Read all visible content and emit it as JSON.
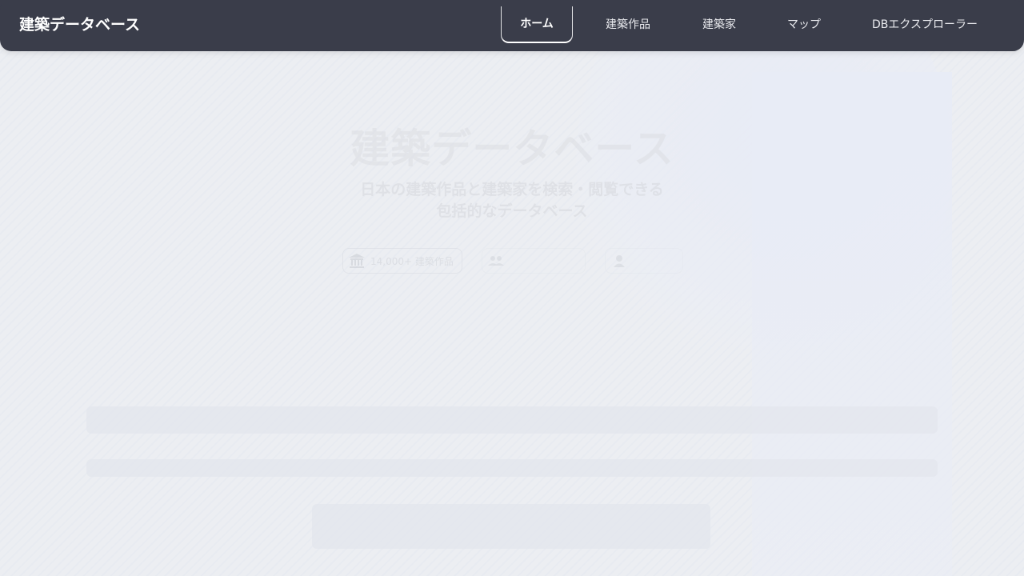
{
  "app": {
    "title": "建築データベース"
  },
  "nav": {
    "items": [
      {
        "label": "ホーム",
        "active": true
      },
      {
        "label": "建築作品",
        "active": false
      },
      {
        "label": "建築家",
        "active": false
      },
      {
        "label": "マップ",
        "active": false
      },
      {
        "label": "DBエクスプローラー",
        "active": false
      }
    ]
  },
  "hero": {
    "title": "建築データベース",
    "subtitle_line1": "日本の建築作品と建築家を検索・閲覧できる",
    "subtitle_line2": "包括的なデータベース",
    "stats": [
      {
        "icon": "building-icon",
        "label": "14,000+ 建築作品"
      },
      {
        "icon": "people-icon",
        "label": ""
      },
      {
        "icon": "person-icon",
        "label": ""
      }
    ]
  },
  "colors": {
    "navbar_bg": "#3a3d4a",
    "page_bg": "#eceef2",
    "nav_text": "#ffffff"
  }
}
